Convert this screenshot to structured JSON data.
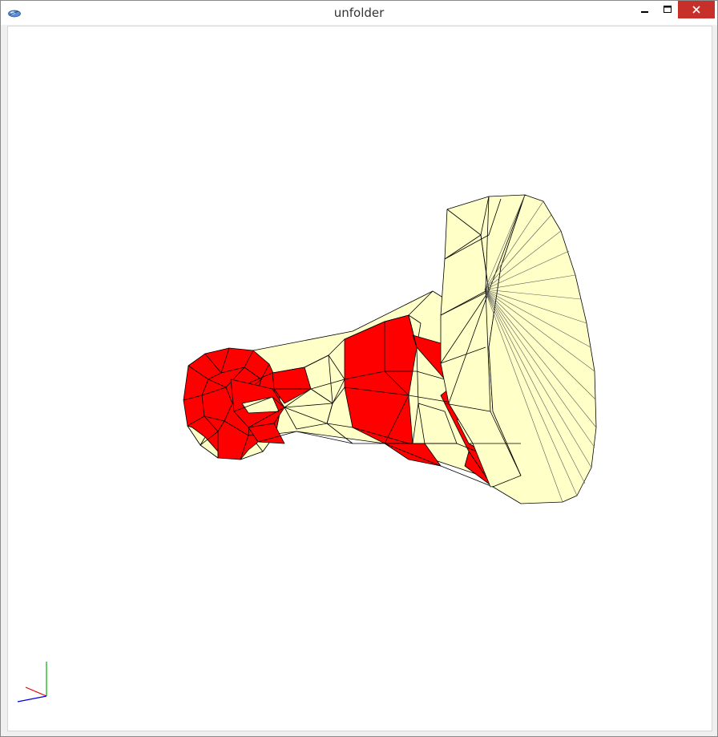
{
  "window": {
    "title": "unfolder",
    "controls": [
      "minimize",
      "maximize",
      "close"
    ]
  },
  "icons": {
    "app": "app-logo-icon",
    "minimize": "minimize-icon",
    "maximize": "maximize-icon",
    "close": "close-icon"
  },
  "colors": {
    "face_red": "#ff0000",
    "face_cream": "#ffffc8",
    "edge": "#000000",
    "close_button": "#c7302a",
    "axis_x": "#e00000",
    "axis_y": "#00b000",
    "axis_z": "#0000e0"
  },
  "viewport": {
    "content": "3d-mesh-horn",
    "axes_gizmo": [
      "x",
      "y",
      "z"
    ]
  }
}
